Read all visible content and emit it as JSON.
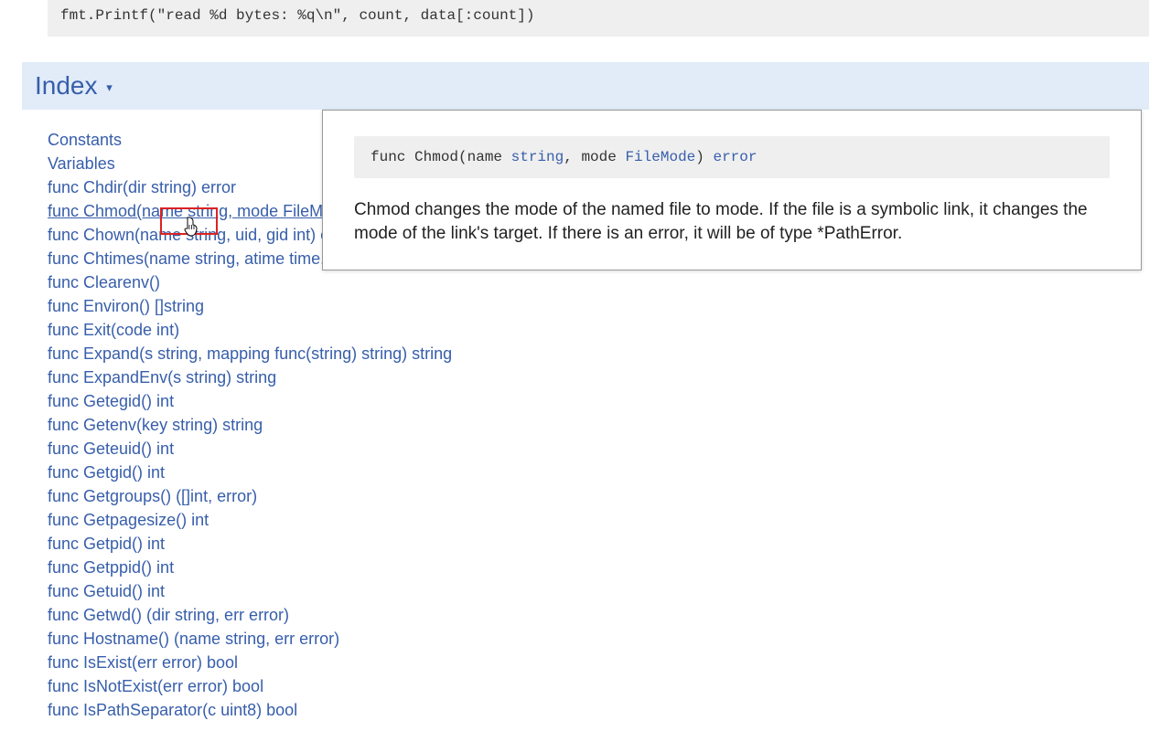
{
  "codeTop": "fmt.Printf(\"read %d bytes: %q\\n\", count, data[:count])",
  "section": {
    "title": "Index",
    "marker": "▾"
  },
  "indexItems": [
    "Constants",
    "Variables",
    "func Chdir(dir string) error",
    "func Chmod(name string, mode FileMode) error",
    "func Chown(name string, uid, gid int) error",
    "func Chtimes(name string, atime time.Time, mtime time.Time) error",
    "func Clearenv()",
    "func Environ() []string",
    "func Exit(code int)",
    "func Expand(s string, mapping func(string) string) string",
    "func ExpandEnv(s string) string",
    "func Getegid() int",
    "func Getenv(key string) string",
    "func Geteuid() int",
    "func Getgid() int",
    "func Getgroups() ([]int, error)",
    "func Getpagesize() int",
    "func Getpid() int",
    "func Getppid() int",
    "func Getuid() int",
    "func Getwd() (dir string, err error)",
    "func Hostname() (name string, err error)",
    "func IsExist(err error) bool",
    "func IsNotExist(err error) bool",
    "func IsPathSeparator(c uint8) bool"
  ],
  "hoveredIndex": 3,
  "popover": {
    "sig": {
      "prefix": "func Chmod(name ",
      "t1": "string",
      "mid": ", mode ",
      "t2": "FileMode",
      "suffix": ") ",
      "t3": "error"
    },
    "desc": "Chmod changes the mode of the named file to mode. If the file is a symbolic link, it changes the mode of the link's target. If there is an error, it will be of type *PathError."
  }
}
